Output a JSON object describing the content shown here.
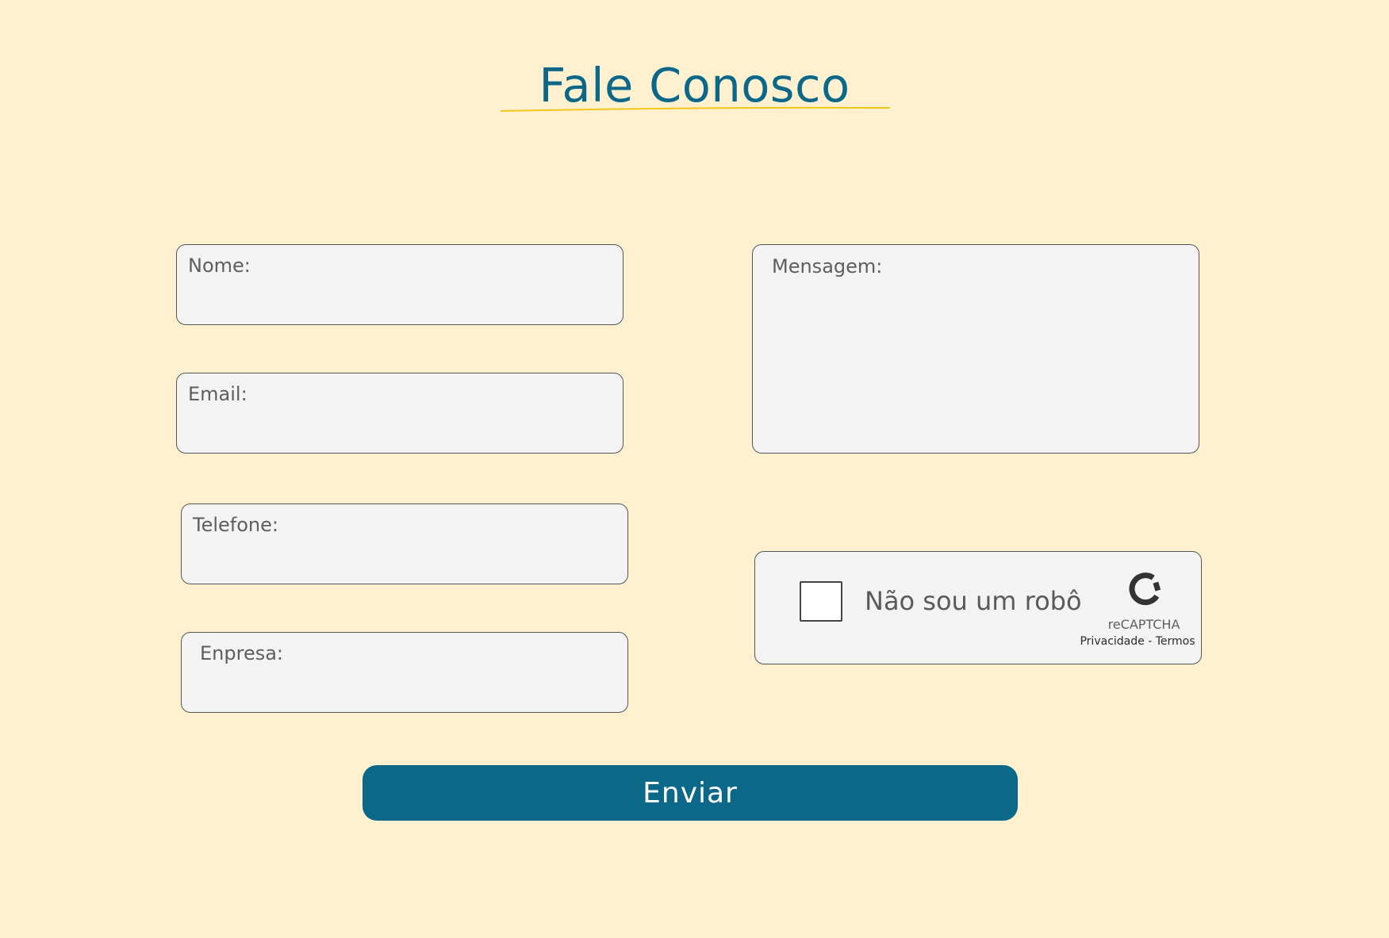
{
  "page": {
    "title": "Fale Conosco"
  },
  "colors": {
    "background": "#FFF1D0",
    "primary": "#0B6889",
    "accent_underline": "#F2C718",
    "field_background": "#F3F3F3",
    "field_border": "#555555",
    "label_text": "#5E5E5E"
  },
  "form": {
    "fields": {
      "nome": {
        "label": "Nome:",
        "value": ""
      },
      "email": {
        "label": "Email:",
        "value": ""
      },
      "telefone": {
        "label": "Telefone:",
        "value": ""
      },
      "empresa": {
        "label": "Enpresa:",
        "value": ""
      },
      "mensagem": {
        "label": "Mensagem:",
        "value": ""
      }
    },
    "captcha": {
      "label": "Não sou um robô",
      "checked": false,
      "brand": "reCAPTCHA",
      "links": "Privacidade - Termos",
      "icon": "recaptcha-icon"
    },
    "submit_label": "Enviar"
  }
}
